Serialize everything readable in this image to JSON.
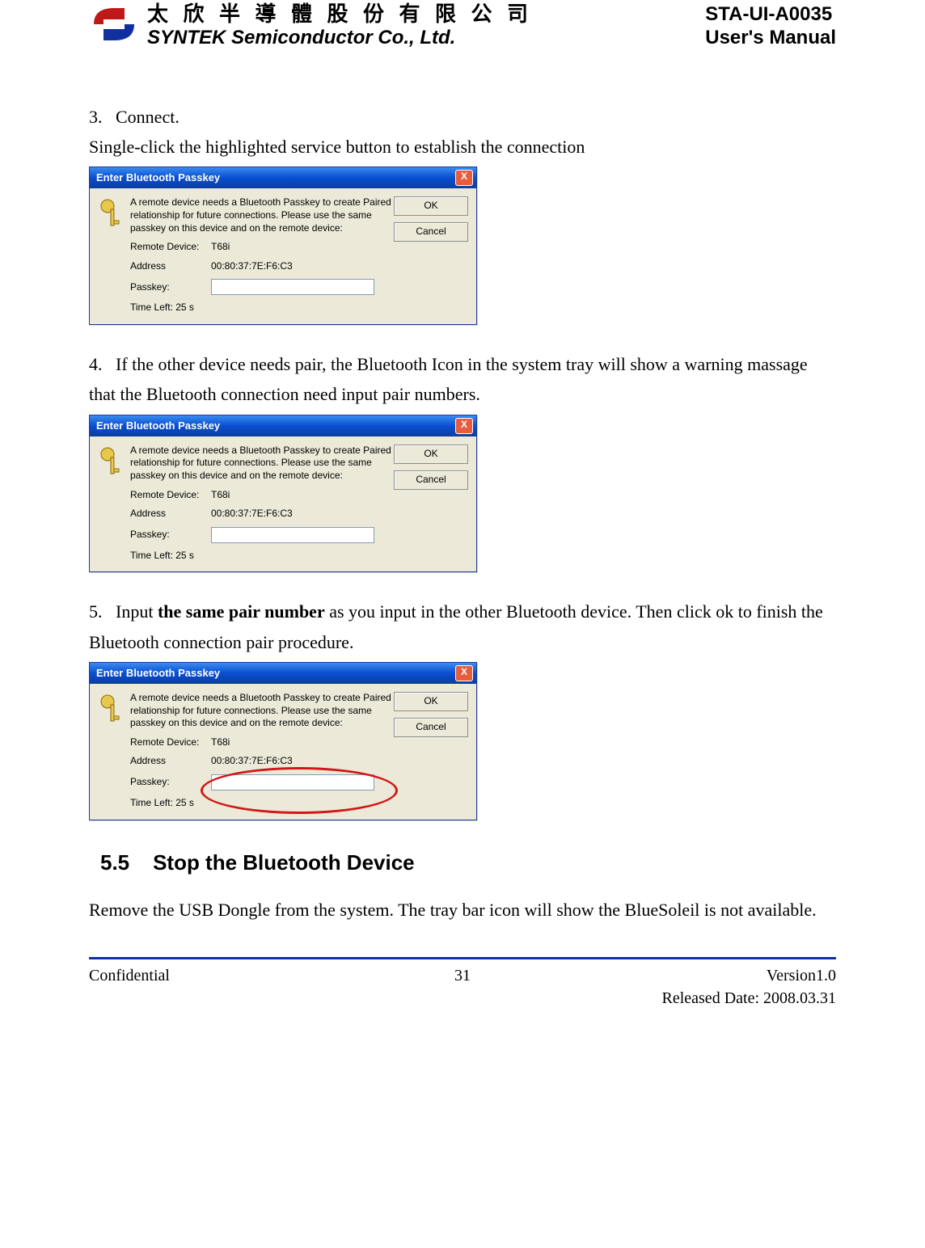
{
  "header": {
    "company_cn": "太 欣 半 導 體 股 份 有 限 公 司",
    "company_en": "SYNTEK Semiconductor Co., Ltd.",
    "doc_code": "STA-UI-A0035",
    "doc_name": "User's Manual"
  },
  "steps": {
    "s3_num": "3.",
    "s3_title": "Connect.",
    "s3_text": "Single-click the highlighted service button to establish the connection",
    "s4_num": "4.",
    "s4_text": "If the other device needs pair, the Bluetooth Icon in the system tray will show a warning massage that the Bluetooth connection need input pair numbers.",
    "s5_num": "5.",
    "s5_pre": "Input ",
    "s5_bold": "the same pair number",
    "s5_post": " as you input in the other Bluetooth device. Then click ok to finish the Bluetooth connection pair procedure."
  },
  "dialog": {
    "title": "Enter Bluetooth Passkey",
    "close": "X",
    "msg": "A remote device needs a Bluetooth Passkey to create Paired relationship for future connections. Please use the same passkey on this device and on the remote device:",
    "ok": "OK",
    "cancel": "Cancel",
    "remote_label": "Remote Device:",
    "remote_value": "T68i",
    "address_label": "Address",
    "address_value": "00:80:37:7E:F6:C3",
    "passkey_label": "Passkey:",
    "time_label": "Time Left: 25 s"
  },
  "section": {
    "num": "5.5",
    "title": "Stop the Bluetooth Device",
    "text": "Remove the USB Dongle from the system. The tray bar icon will show the BlueSoleil is not available."
  },
  "footer": {
    "left": "Confidential",
    "page": "31",
    "version": "Version1.0",
    "date": "Released Date: 2008.03.31"
  }
}
